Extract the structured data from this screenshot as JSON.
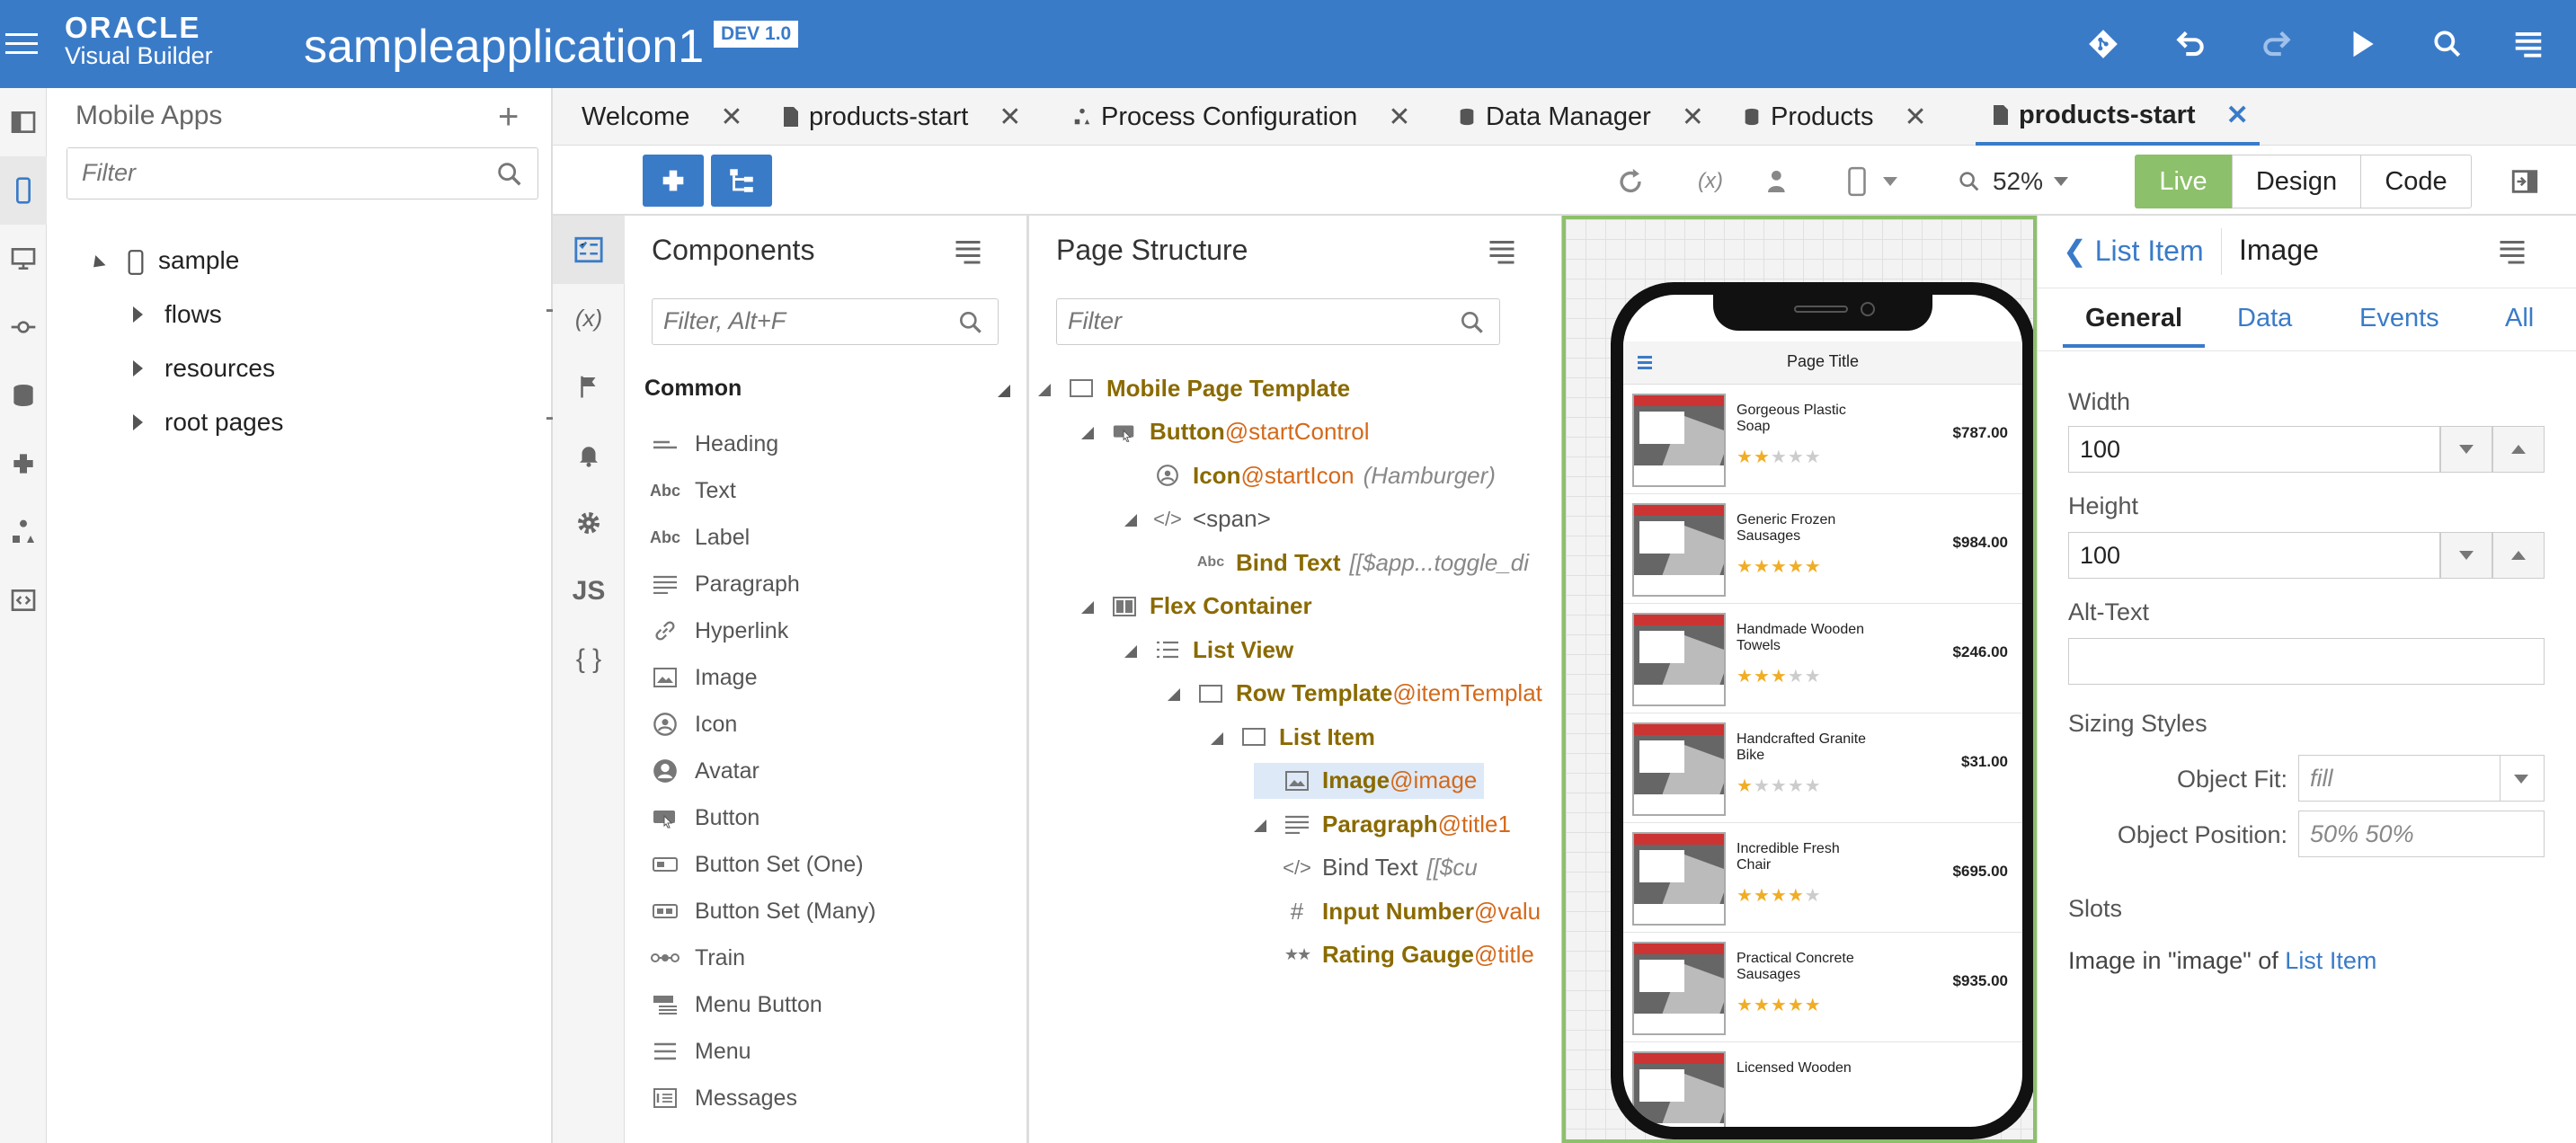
{
  "header": {
    "logo_top": "ORACLE",
    "logo_bottom": "Visual Builder",
    "app_name": "sampleapplication1",
    "badge": "DEV 1.0"
  },
  "nav": {
    "title": "Mobile Apps",
    "filter_placeholder": "Filter",
    "root": "sample",
    "children": [
      "flows",
      "resources",
      "root pages"
    ]
  },
  "tabs": [
    {
      "label": "Welcome"
    },
    {
      "label": "products-start"
    },
    {
      "label": "Process Configuration"
    },
    {
      "label": "Data Manager"
    },
    {
      "label": "Products"
    },
    {
      "label": "products-start"
    }
  ],
  "toolbar": {
    "zoom": "52%",
    "live": "Live",
    "design": "Design",
    "code": "Code"
  },
  "sidebar2": {
    "vars": "(x)",
    "js": "JS",
    "json": "{ }"
  },
  "components": {
    "title": "Components",
    "filter_placeholder": "Filter, Alt+F",
    "section": "Common",
    "items": [
      "Heading",
      "Text",
      "Label",
      "Paragraph",
      "Hyperlink",
      "Image",
      "Icon",
      "Avatar",
      "Button",
      "Button Set (One)",
      "Button Set (Many)",
      "Train",
      "Menu Button",
      "Menu",
      "Messages"
    ]
  },
  "structure": {
    "title": "Page Structure",
    "filter_placeholder": "Filter",
    "nodes": [
      {
        "name": "Mobile Page Template",
        "id": "",
        "hint": "",
        "tag": ""
      },
      {
        "name": "Button",
        "id": "@startControl",
        "hint": "",
        "tag": ""
      },
      {
        "name": "Icon",
        "id": "@startIcon",
        "hint": "(Hamburger)",
        "tag": ""
      },
      {
        "name": "",
        "id": "",
        "hint": "",
        "tag": "<span>"
      },
      {
        "name": "Bind Text",
        "id": "",
        "hint": "[[$app...toggle_di",
        "tag": ""
      },
      {
        "name": "Flex Container",
        "id": "",
        "hint": "",
        "tag": ""
      },
      {
        "name": "List View",
        "id": "",
        "hint": "",
        "tag": ""
      },
      {
        "name": "Row Template",
        "id": "@itemTemplat",
        "hint": "",
        "tag": ""
      },
      {
        "name": "List Item",
        "id": "",
        "hint": "",
        "tag": ""
      },
      {
        "name": "Image",
        "id": "@image",
        "hint": "",
        "tag": ""
      },
      {
        "name": "Paragraph",
        "id": "@title1",
        "hint": "",
        "tag": ""
      },
      {
        "name": "Bind Text",
        "id": "",
        "hint": "[[$cu",
        "tag": ""
      },
      {
        "name": "Input Number",
        "id": "@valu",
        "hint": "",
        "tag": ""
      },
      {
        "name": "Rating Gauge",
        "id": "@title",
        "hint": "",
        "tag": ""
      }
    ]
  },
  "phone": {
    "page_title": "Page Title",
    "products": [
      {
        "name": "Gorgeous Plastic Soap",
        "price": "$787.00",
        "rating": 2
      },
      {
        "name": "Generic Frozen Sausages",
        "price": "$984.00",
        "rating": 5
      },
      {
        "name": "Handmade Wooden Towels",
        "price": "$246.00",
        "rating": 3
      },
      {
        "name": "Handcrafted Granite Bike",
        "price": "$31.00",
        "rating": 1
      },
      {
        "name": "Incredible Fresh Chair",
        "price": "$695.00",
        "rating": 4
      },
      {
        "name": "Practical Concrete Sausages",
        "price": "$935.00",
        "rating": 5
      },
      {
        "name": "Licensed Wooden",
        "price": "",
        "rating": 0
      }
    ]
  },
  "properties": {
    "back_label": "List Item",
    "title": "Image",
    "tabs": [
      "General",
      "Data",
      "Events",
      "All"
    ],
    "width_label": "Width",
    "width_value": "100",
    "height_label": "Height",
    "height_value": "100",
    "alt_label": "Alt-Text",
    "alt_value": "",
    "sizing_label": "Sizing Styles",
    "fit_label": "Object Fit:",
    "fit_placeholder": "fill",
    "position_label": "Object Position:",
    "position_placeholder": "50% 50%",
    "slots_label": "Slots",
    "slots_text": "Image in \"image\" of ",
    "slots_link": "List Item"
  },
  "colors": {
    "brand": "#3a7bc8",
    "live": "#8cc06a",
    "star": "#f0ad25",
    "node": "#8a6a00",
    "id": "#d4691a"
  }
}
